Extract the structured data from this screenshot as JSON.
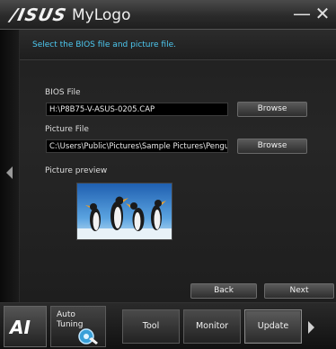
{
  "window": {
    "brand": "/ISUS",
    "title": "MyLogo",
    "minimize_glyph": "—",
    "close_glyph": "✕"
  },
  "instruction": "Select the BIOS file and picture file.",
  "bios": {
    "label": "BIOS File",
    "path": "H:\\P8B75-V-ASUS-0205.CAP",
    "browse_label": "Browse"
  },
  "picture": {
    "label": "Picture File",
    "path": "C:\\Users\\Public\\Pictures\\Sample Pictures\\Penguins.jpg",
    "browse_label": "Browse"
  },
  "preview": {
    "label": "Picture preview"
  },
  "wizard": {
    "back_label": "Back",
    "next_label": "Next"
  },
  "nav": {
    "ai_label": "AI",
    "auto_tuning_label": "Auto Tuning",
    "tabs": [
      {
        "label": "Tool"
      },
      {
        "label": "Monitor"
      },
      {
        "label": "Update"
      }
    ],
    "active_tab": "Update"
  },
  "colors": {
    "accent": "#4dc8f0",
    "background": "#0c0c0c",
    "panel": "#222222"
  },
  "icons": {
    "left_rail": "chevron-left-icon",
    "auto_tuning": "tuning-dial-icon",
    "nav_next": "chevron-right-icon"
  }
}
